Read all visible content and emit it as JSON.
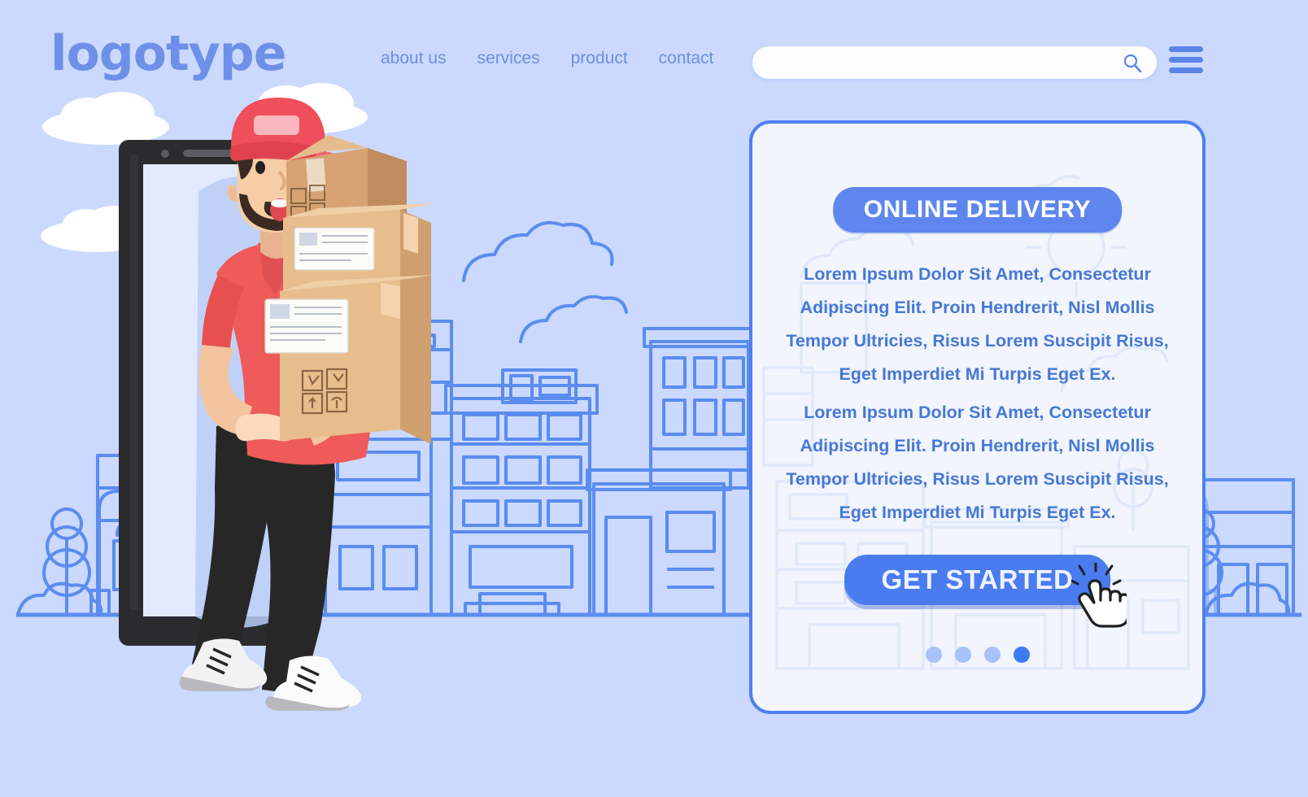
{
  "header": {
    "logo": "logotype",
    "nav": [
      {
        "label": "about us"
      },
      {
        "label": "services"
      },
      {
        "label": "product"
      },
      {
        "label": "contact"
      }
    ],
    "search": {
      "value": "",
      "placeholder": "",
      "icon": "search-icon"
    },
    "menu_icon": "hamburger-menu-icon"
  },
  "card": {
    "badge": "ONLINE DELIVERY",
    "paragraph_1": "Lorem Ipsum Dolor Sit Amet, Consectetur Adipiscing Elit. Proin Hendrerit, Nisl Mollis Tempor Ultricies, Risus Lorem Suscipit Risus, Eget Imperdiet Mi Turpis Eget Ex.",
    "paragraph_2": "Lorem Ipsum Dolor Sit Amet, Consectetur Adipiscing Elit. Proin Hendrerit, Nisl Mollis Tempor Ultricies, Risus Lorem Suscipit Risus, Eget Imperdiet Mi Turpis Eget Ex.",
    "cta_label": "GET STARTED",
    "cursor_icon": "hand-pointer-cursor-icon",
    "pagination": [
      {
        "active": false
      },
      {
        "active": false
      },
      {
        "active": false
      },
      {
        "active": true
      }
    ]
  },
  "illustration": {
    "scene": "delivery-man-with-boxes-stepping-out-of-tablet",
    "device_icon": "tablet-device-icon",
    "person_icon": "delivery-courier-icon",
    "boxes_icon": "cardboard-parcel-boxes-icon",
    "background_icon": "city-skyline-line-art-icon",
    "clouds_icon": "cloud-icon",
    "tree_icon": "tree-icon",
    "lamp_icon": "street-lamp-icon"
  },
  "colors": {
    "page_background": "#cbd9fe",
    "brand_blue": "#6e90e8",
    "accent_blue": "#4a7cf0",
    "card_background": "#f2f5fd",
    "card_border": "#4f7ff0",
    "nav_text": "#6d8fe0",
    "body_text": "#4678d6",
    "badge_background": "#5e86ee",
    "shirt_red": "#ef5a5a",
    "cap_red": "#ee4f5a",
    "box_tan": "#e0b183",
    "device_black": "#2b2b2e",
    "cloud_white": "#ffffff",
    "line_art_blue": "#5b8cf0",
    "dot_inactive": "#a8c2fb",
    "dot_active": "#3f7bf0"
  }
}
